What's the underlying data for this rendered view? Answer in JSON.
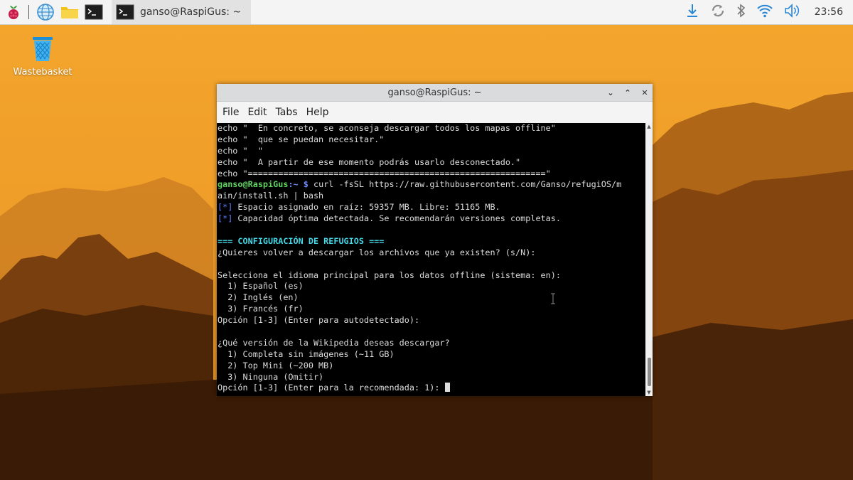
{
  "taskbar": {
    "launchers": [
      "raspberry-menu",
      "web-browser",
      "file-manager",
      "terminal"
    ],
    "window_title": "ganso@RaspiGus: ~",
    "clock": "23:56"
  },
  "desktop": {
    "icons": [
      {
        "label": "Wastebasket"
      }
    ]
  },
  "terminal": {
    "title": "ganso@RaspiGus: ~",
    "menu": [
      "File",
      "Edit",
      "Tabs",
      "Help"
    ],
    "lines": [
      "echo \"  En concreto, se aconseja descargar todos los mapas offline\"",
      "echo \"  que se puedan necesitar.\"",
      "echo \"  \"",
      "echo \"  A partir de ese momento podrás usarlo desconectado.\"",
      "echo \"===========================================================\""
    ],
    "prompt_user": "ganso@RaspiGus",
    "prompt_path": ":~ $",
    "command_line1": " curl -fsSL https://raw.githubusercontent.com/Ganso/refugiOS/m",
    "command_line2": "ain/install.sh | bash",
    "info_tag": "[*]",
    "info1": " Espacio asignado en raíz: 59357 MB. Libre: 51165 MB.",
    "info2": " Capacidad óptima detectada. Se recomendarán versiones completas.",
    "section_header": "=== CONFIGURACIÓN DE REFUGIOS ===",
    "q_redownload": "¿Quieres volver a descargar los archivos que ya existen? (s/N):",
    "q_language": "Selecciona el idioma principal para los datos offline (sistema: en):",
    "lang_options": [
      "  1) Español (es)",
      "  2) Inglés (en)",
      "  3) Francés (fr)"
    ],
    "lang_prompt": "Opción [1-3] (Enter para autodetectado):",
    "q_wiki": "¿Qué versión de la Wikipedia deseas descargar?",
    "wiki_options": [
      "  1) Completa sin imágenes (~11 GB)",
      "  2) Top Mini (~200 MB)",
      "  3) Ninguna (Omitir)"
    ],
    "wiki_prompt": "Opción [1-3] (Enter para la recomendada: 1): "
  }
}
